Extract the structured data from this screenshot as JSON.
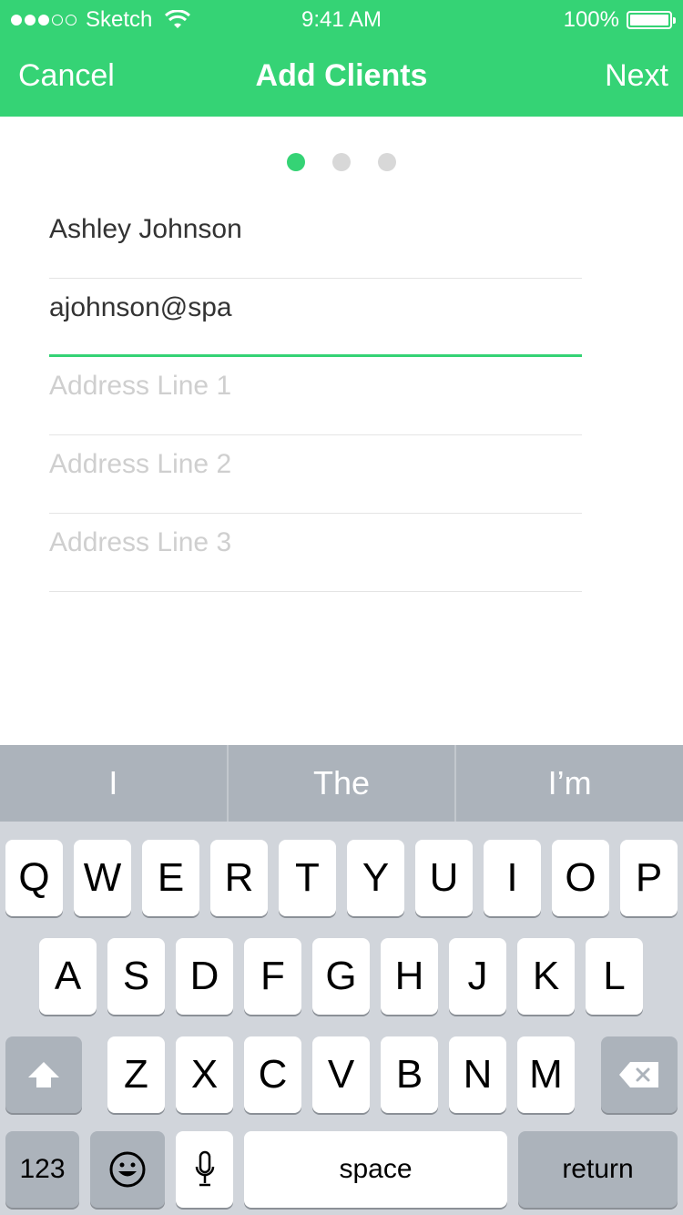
{
  "status_bar": {
    "carrier": "Sketch",
    "time": "9:41 AM",
    "battery": "100%"
  },
  "nav": {
    "cancel": "Cancel",
    "title": "Add Clients",
    "next": "Next"
  },
  "pager": {
    "total": 3,
    "active": 1
  },
  "form": {
    "name_value": "Ashley Johnson",
    "email_value": "ajohnson@spa",
    "address1_placeholder": "Address Line 1",
    "address2_placeholder": "Address Line 2",
    "address3_placeholder": "Address Line 3"
  },
  "keyboard": {
    "suggestions": [
      "I",
      "The",
      "I’m"
    ],
    "row1": [
      "Q",
      "W",
      "E",
      "R",
      "T",
      "Y",
      "U",
      "I",
      "O",
      "P"
    ],
    "row2": [
      "A",
      "S",
      "D",
      "F",
      "G",
      "H",
      "J",
      "K",
      "L"
    ],
    "row3": [
      "Z",
      "X",
      "C",
      "V",
      "B",
      "N",
      "M"
    ],
    "numbers": "123",
    "space": "space",
    "return": "return"
  },
  "colors": {
    "accent": "#35d375",
    "keyboard_bg": "#d1d5db",
    "suggestion_bg": "#acb3bb"
  }
}
